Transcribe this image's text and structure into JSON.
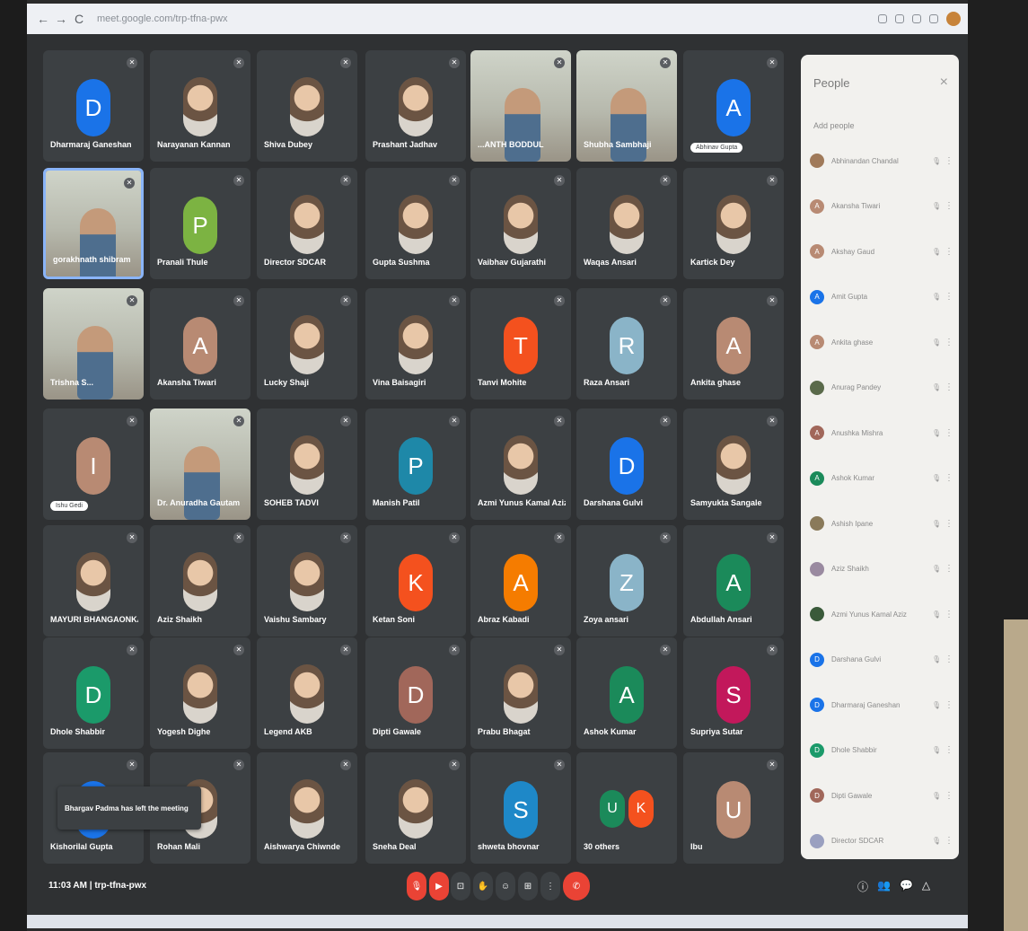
{
  "browser": {
    "back": "←",
    "forward": "→",
    "reload": "C",
    "url": "meet.google.com/trp-tfna-pwx"
  },
  "tiles": [
    {
      "name": "Dharmaraj Ganeshan",
      "kind": "letter",
      "letter": "D",
      "color": "#1a73e8"
    },
    {
      "name": "Narayanan Kannan",
      "kind": "photo"
    },
    {
      "name": "Shiva Dubey",
      "kind": "photo"
    },
    {
      "name": "Prashant Jadhav",
      "kind": "photo"
    },
    {
      "name": "...ANTH BODDUL",
      "kind": "camera"
    },
    {
      "name": "Shubha Sambhaji",
      "kind": "camera"
    },
    {
      "name": "",
      "kind": "letter",
      "letter": "A",
      "color": "#1a73e8",
      "chip": "Abhinav Gupta"
    },
    {
      "name": "gorakhnath shibram",
      "kind": "camera",
      "active": true
    },
    {
      "name": "Pranali Thule",
      "kind": "letter",
      "letter": "P",
      "color": "#7cb342"
    },
    {
      "name": "Director SDCAR",
      "kind": "photo"
    },
    {
      "name": "Gupta Sushma",
      "kind": "photo"
    },
    {
      "name": "Vaibhav Gujarathi",
      "kind": "photo"
    },
    {
      "name": "Waqas Ansari",
      "kind": "photo"
    },
    {
      "name": "Kartick Dey",
      "kind": "photo"
    },
    {
      "name": "Trishna S...",
      "kind": "camera"
    },
    {
      "name": "Akansha Tiwari",
      "kind": "letter",
      "letter": "A",
      "color": "#b88a73"
    },
    {
      "name": "Lucky Shaji",
      "kind": "photo"
    },
    {
      "name": "Vina Baisagiri",
      "kind": "photo"
    },
    {
      "name": "Tanvi Mohite",
      "kind": "letter",
      "letter": "T",
      "color": "#f4511e"
    },
    {
      "name": "Raza Ansari",
      "kind": "letter",
      "letter": "R",
      "color": "#8ab4c8"
    },
    {
      "name": "Ankita ghase",
      "kind": "letter",
      "letter": "A",
      "color": "#b88a73"
    },
    {
      "name": "",
      "kind": "letter",
      "letter": "I",
      "color": "#b88a73",
      "chip": "Ishu Gedi"
    },
    {
      "name": "Dr. Anuradha Gautam",
      "kind": "camera"
    },
    {
      "name": "SOHEB TADVI",
      "kind": "photo"
    },
    {
      "name": "Manish Patil",
      "kind": "letter",
      "letter": "P",
      "color": "#1e88a8"
    },
    {
      "name": "Azmi Yunus Kamal Aziz",
      "kind": "photo"
    },
    {
      "name": "Darshana Gulvi",
      "kind": "letter",
      "letter": "D",
      "color": "#1a73e8"
    },
    {
      "name": "Samyukta Sangale",
      "kind": "photo"
    },
    {
      "name": "MAYURI BHANGAONKAR",
      "kind": "photo"
    },
    {
      "name": "Aziz Shaikh",
      "kind": "photo"
    },
    {
      "name": "Vaishu Sambary",
      "kind": "photo"
    },
    {
      "name": "Ketan Soni",
      "kind": "letter",
      "letter": "K",
      "color": "#f4511e"
    },
    {
      "name": "Abraz Kabadi",
      "kind": "letter",
      "letter": "A",
      "color": "#f57c00"
    },
    {
      "name": "Zoya ansari",
      "kind": "letter",
      "letter": "Z",
      "color": "#8ab4c8"
    },
    {
      "name": "Abdullah Ansari",
      "kind": "letter",
      "letter": "A",
      "color": "#1b8a5a"
    },
    {
      "name": "Dhole Shabbir",
      "kind": "letter",
      "letter": "D",
      "color": "#1b9a6a"
    },
    {
      "name": "Yogesh Dighe",
      "kind": "photo"
    },
    {
      "name": "Legend AKB",
      "kind": "photo"
    },
    {
      "name": "Dipti Gawale",
      "kind": "letter",
      "letter": "D",
      "color": "#a1675a"
    },
    {
      "name": "Prabu Bhagat",
      "kind": "photo"
    },
    {
      "name": "Ashok Kumar",
      "kind": "letter",
      "letter": "A",
      "color": "#1b8a5a"
    },
    {
      "name": "Supriya Sutar",
      "kind": "letter",
      "letter": "S",
      "color": "#c2185b"
    },
    {
      "name": "Kishorilal Gupta",
      "kind": "letter",
      "letter": "",
      "color": "#1a73e8"
    },
    {
      "name": "Rohan Mali",
      "kind": "photo"
    },
    {
      "name": "Aishwarya Chiwnde",
      "kind": "photo"
    },
    {
      "name": "Sneha Deal",
      "kind": "photo"
    },
    {
      "name": "shweta bhovnar",
      "kind": "letter",
      "letter": "S",
      "color": "#1e88c8"
    },
    {
      "name": "30 others",
      "kind": "others",
      "letters": [
        "U",
        "K"
      ]
    },
    {
      "name": "Ibu",
      "kind": "letter",
      "letter": "U",
      "color": "#b88a73"
    }
  ],
  "toast": {
    "text": "Bhargav Padma has left the meeting"
  },
  "people_panel": {
    "title": "People",
    "close": "×",
    "add_people": "Add people",
    "members": [
      {
        "name": "Abhinandan Chandal",
        "letter": "",
        "color": "#a07a5a"
      },
      {
        "name": "Akansha Tiwari",
        "letter": "A",
        "color": "#b88a73"
      },
      {
        "name": "Akshay Gaud",
        "letter": "A",
        "color": "#b88a73"
      },
      {
        "name": "Amit Gupta",
        "letter": "A",
        "color": "#1a73e8"
      },
      {
        "name": "Ankita ghase",
        "letter": "A",
        "color": "#b88a73"
      },
      {
        "name": "Anurag Pandey",
        "letter": "",
        "color": "#5a6a4a"
      },
      {
        "name": "Anushka Mishra",
        "letter": "A",
        "color": "#a1675a"
      },
      {
        "name": "Ashok Kumar",
        "letter": "A",
        "color": "#1b8a5a"
      },
      {
        "name": "Ashish Ipane",
        "letter": "",
        "color": "#8a7a5a"
      },
      {
        "name": "Aziz Shaikh",
        "letter": "",
        "color": "#9a8aa0"
      },
      {
        "name": "Azmi Yunus Kamal Aziz",
        "letter": "",
        "color": "#3a5a3a"
      },
      {
        "name": "Darshana Gulvi",
        "letter": "D",
        "color": "#1a73e8"
      },
      {
        "name": "Dharmaraj Ganeshan",
        "letter": "D",
        "color": "#1a73e8"
      },
      {
        "name": "Dhole Shabbir",
        "letter": "D",
        "color": "#1b9a6a"
      },
      {
        "name": "Dipti Gawale",
        "letter": "D",
        "color": "#a1675a"
      },
      {
        "name": "Director SDCAR",
        "letter": "",
        "color": "#9aa0c0"
      }
    ]
  },
  "bottom": {
    "clock": "11:03 AM | trp-tfna-pwx",
    "controls": [
      "mic",
      "cam",
      "cc",
      "raise",
      "emoji",
      "present",
      "more",
      "end"
    ],
    "control_glyphs": [
      "🎙",
      "▶",
      "⊡",
      "✋",
      "☺",
      "⊞",
      "⋮",
      "✆"
    ],
    "right": [
      "ⓘ",
      "👥",
      "💬",
      "△"
    ]
  },
  "colors": {
    "tile_bg": "#3c4043",
    "end_call": "#ea4335",
    "active_border": "#8ab4f8"
  }
}
